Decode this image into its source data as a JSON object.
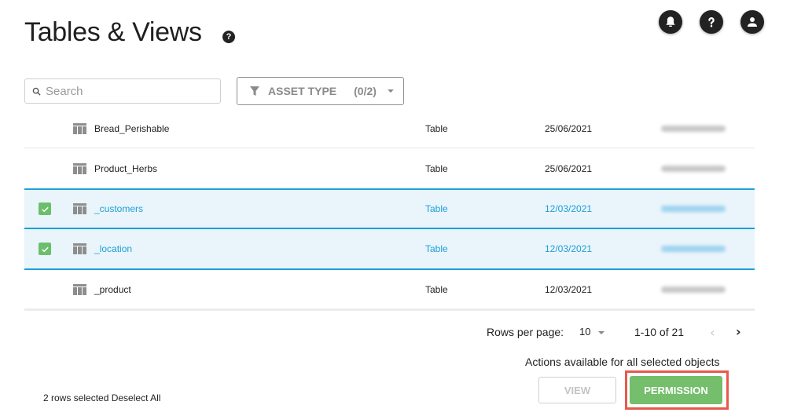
{
  "header": {
    "title": "Tables & Views",
    "title_help_icon": "question-circle-icon",
    "top_icons": [
      "bell-icon",
      "help-icon",
      "user-icon"
    ]
  },
  "toolbar": {
    "search_placeholder": "Search",
    "search_value": "",
    "asset_type_label": "ASSET TYPE",
    "asset_type_count": "(0/2)"
  },
  "table": {
    "rows": [
      {
        "name": "Bread_Perishable",
        "type": "Table",
        "date": "25/06/2021",
        "selected": false
      },
      {
        "name": "Product_Herbs",
        "type": "Table",
        "date": "25/06/2021",
        "selected": false
      },
      {
        "name": "_customers",
        "type": "Table",
        "date": "12/03/2021",
        "selected": true
      },
      {
        "name": "_location",
        "type": "Table",
        "date": "12/03/2021",
        "selected": true
      },
      {
        "name": "_product",
        "type": "Table",
        "date": "12/03/2021",
        "selected": false
      }
    ]
  },
  "pagination": {
    "rows_per_page_label": "Rows per page:",
    "rows_per_page_value": "10",
    "range": "1-10 of 21",
    "prev": "‹",
    "next": "›"
  },
  "actions": {
    "label": "Actions available for all selected objects",
    "view_label": "VIEW",
    "permission_label": "PERMISSION"
  },
  "selection": {
    "count_text": "2 rows selected",
    "deselect_label": "Deselect All"
  },
  "colors": {
    "accent_blue": "#1aa0d6",
    "selected_bg": "#eaf4fb",
    "check_green": "#6cbf6a",
    "permission_green": "#74be6c",
    "highlight_red": "#e8594c"
  }
}
